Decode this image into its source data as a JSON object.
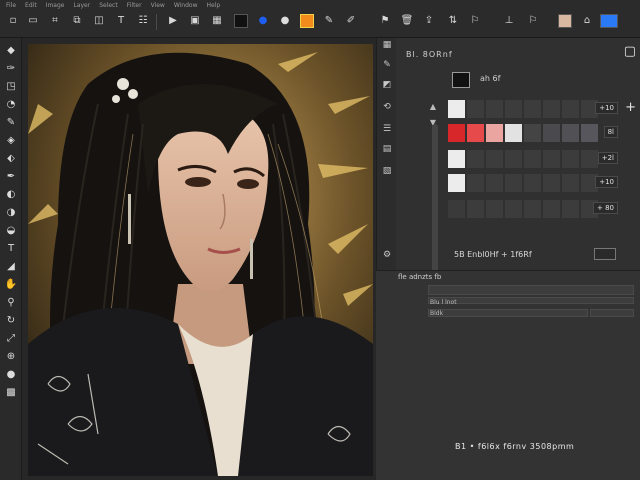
{
  "app": {
    "menu": [
      "File",
      "Edit",
      "Image",
      "Layer",
      "Select",
      "Filter",
      "View",
      "Window",
      "Help",
      "",
      "",
      "",
      ""
    ]
  },
  "toolbar": {
    "colors": {
      "black": "#111111",
      "blue_circle": "#1e5ef0",
      "dark_drop": "#1a1a1a",
      "orange": "#f28a1c",
      "yellow": "#f2d24a",
      "light_blue": "#2a79f5"
    },
    "buttons": [
      "new-icon",
      "open-icon",
      "save-icon",
      "export-icon",
      "image-icon",
      "text-icon",
      "folder-icon",
      "share-icon",
      "flag-icon",
      "bookmark-icon",
      "pin-icon"
    ]
  },
  "color_panel": {
    "header": "Bl. 8ORnf",
    "chip_label": "ah 6f",
    "rows": [
      {
        "value": "+10"
      },
      {
        "value": "8l"
      },
      {
        "value": "+2l"
      },
      {
        "value": "+10"
      },
      {
        "value": "+ 80"
      }
    ],
    "row2_colors": [
      "#d7272a",
      "#e74a4a",
      "#eba5a0",
      "#e2e2e2"
    ],
    "footer": "5B  Enbl0Hf  +  1f6Rf"
  },
  "layers": {
    "header": "fle  adnzts  fb",
    "row_labels": [
      "Blu l lnot",
      "",
      "Bldk"
    ]
  },
  "status": {
    "text": "B1 • f6l6x f6rnv  3508pmm"
  }
}
